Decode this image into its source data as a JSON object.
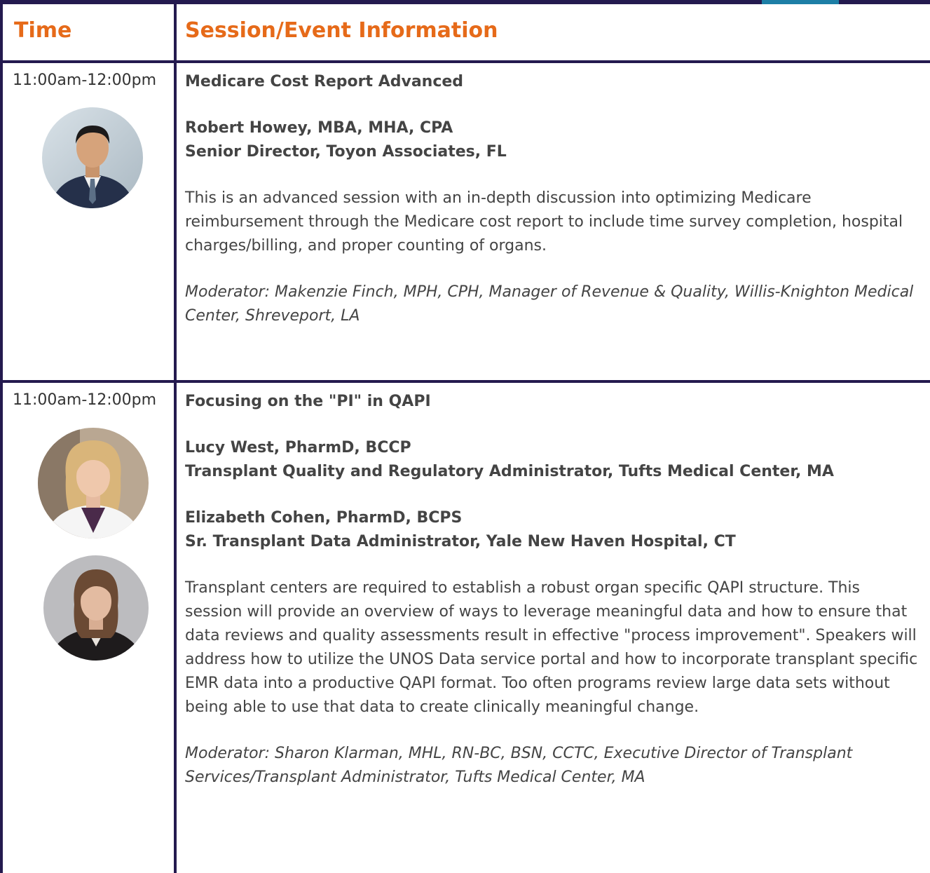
{
  "header": {
    "time_label": "Time",
    "session_label": "Session/Event Information"
  },
  "colors": {
    "border": "#241a4f",
    "accent": "#e66a19"
  },
  "sessions": [
    {
      "time": "11:00am-12:00pm",
      "title": "Medicare Cost Report Advanced",
      "speakers": [
        {
          "name": "Robert Howey, MBA, MHA, CPA",
          "role": "Senior Director, Toyon Associates, FL"
        }
      ],
      "description": "This is an advanced session with an in-depth discussion into optimizing Medicare reimbursement through the Medicare cost report to include time survey completion, hospital charges/billing, and proper counting of organs.",
      "moderator": "Moderator: Makenzie Finch, MPH, CPH, Manager of Revenue & Quality, Willis-Knighton Medical Center, Shreveport, LA"
    },
    {
      "time": "11:00am-12:00pm",
      "title": "Focusing on the \"PI\" in QAPI",
      "speakers": [
        {
          "name": "Lucy West, PharmD, BCCP",
          "role": "Transplant Quality and Regulatory Administrator, Tufts Medical Center, MA"
        },
        {
          "name": "Elizabeth Cohen, PharmD, BCPS",
          "role": "Sr. Transplant Data Administrator, Yale New Haven Hospital, CT"
        }
      ],
      "description": "Transplant centers are required to establish a robust organ specific QAPI structure. This session will provide an overview of ways to leverage meaningful data and how to ensure that data reviews and quality assessments result in effective \"process improvement\". Speakers will address how to utilize the UNOS Data service portal and how to incorporate transplant specific EMR data into a productive QAPI format. Too often programs review large data sets without being able to use that data to create clinically meaningful change.",
      "moderator": "Moderator: Sharon Klarman, MHL, RN-BC, BSN, CCTC, Executive Director of Transplant Services/Transplant Administrator, Tufts Medical Center, MA"
    }
  ]
}
